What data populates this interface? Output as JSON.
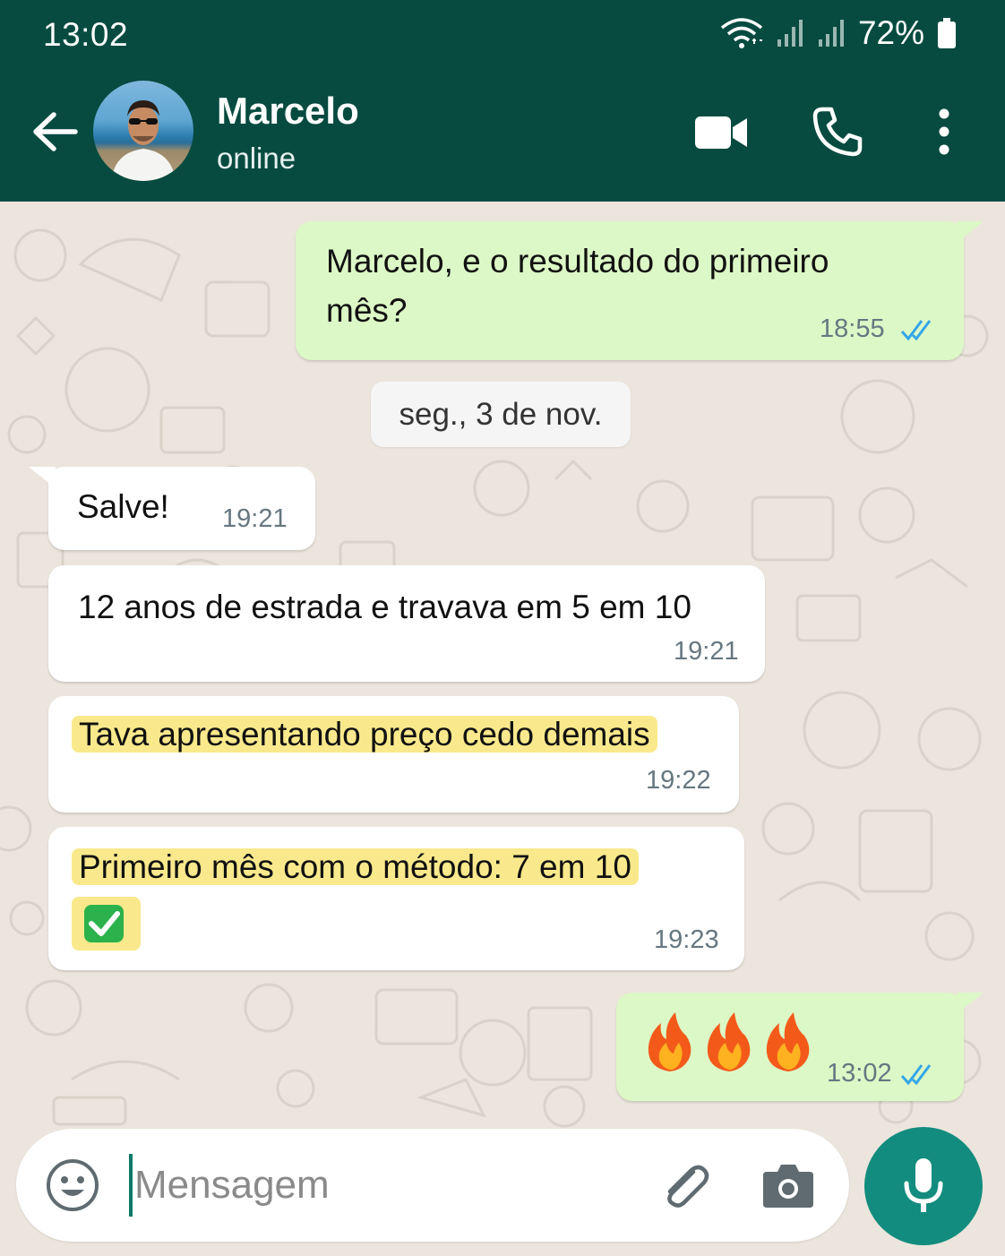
{
  "status_bar": {
    "time": "13:02",
    "battery": "72%"
  },
  "header": {
    "contact_name": "Marcelo",
    "contact_status": "online"
  },
  "messages": [
    {
      "direction": "outgoing",
      "lines": [
        "Marcelo, e o resultado do primeiro",
        "mês?"
      ],
      "time": "18:55",
      "read": true
    },
    {
      "direction": "incoming",
      "text": "Salve!",
      "time": "19:21"
    },
    {
      "direction": "incoming",
      "text": "12 anos de estrada e travava em 5 em 10",
      "time": "19:21"
    },
    {
      "direction": "incoming",
      "text": "Tava apresentando preço cedo demais",
      "time": "19:22",
      "highlighted": true
    },
    {
      "direction": "incoming",
      "text": "Primeiro mês com o método: 7 em 10",
      "emoji": "✅",
      "time": "19:23",
      "highlighted": true
    },
    {
      "direction": "outgoing",
      "text": "🔥🔥🔥",
      "time": "13:02",
      "read": true
    }
  ],
  "date_divider": "seg., 3 de nov.",
  "composer": {
    "placeholder": "Mensagem"
  },
  "colors": {
    "header_bg": "#074b40",
    "outgoing_bubble": "#dcf8c6",
    "incoming_bubble": "#ffffff",
    "chat_bg": "#ece5dd",
    "read_ticks": "#34a6e8",
    "highlight": "#fae98c",
    "mic_button": "#128c7e"
  },
  "icons": {
    "back": "arrow-left-icon",
    "video": "video-camera-icon",
    "call": "phone-icon",
    "menu": "more-vertical-icon",
    "emoji": "smiley-icon",
    "attach": "paperclip-icon",
    "camera": "camera-icon",
    "mic": "microphone-icon"
  }
}
